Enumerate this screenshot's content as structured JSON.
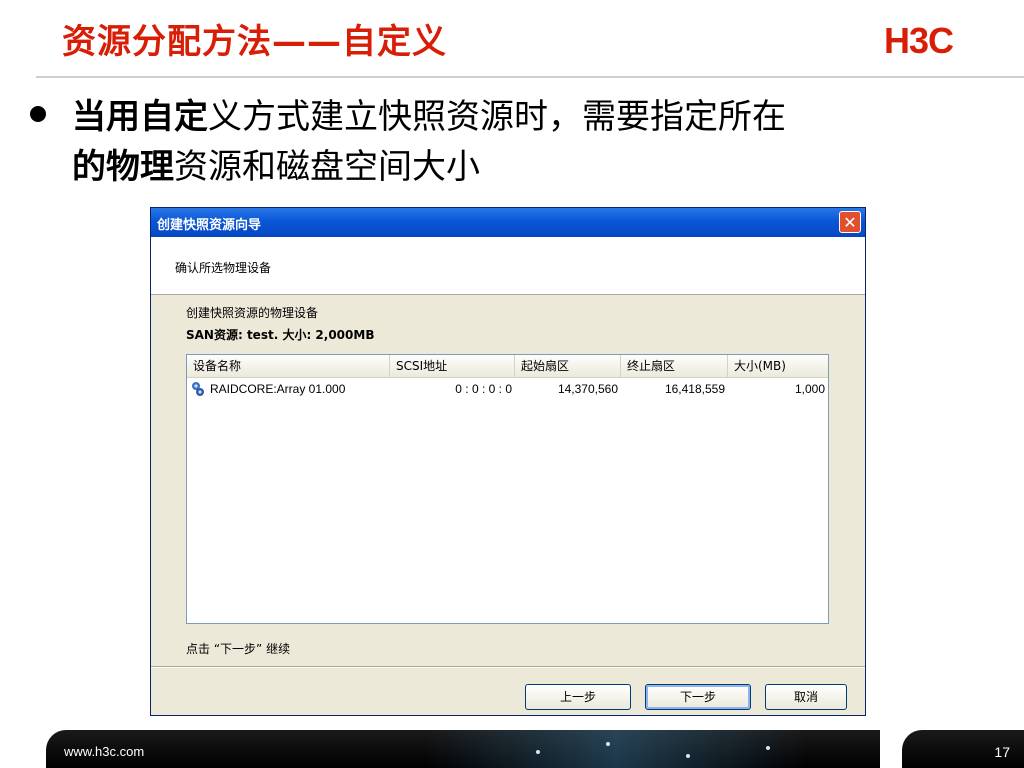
{
  "slide": {
    "title": "资源分配方法——自定义",
    "logo": "H3C",
    "bullet_bold_a": "当用自定",
    "bullet_rest_a": "义方式建立快照资源时，需要指定所在",
    "bullet_bold_b": "的物理",
    "bullet_rest_b": "资源和磁盘空间大小",
    "footer_url": "www.h3c.com",
    "page_number": "17"
  },
  "dialog": {
    "title": "创建快照资源向导",
    "close_glyph": "✕",
    "header": "确认所选物理设备",
    "label_devices": "创建快照资源的物理设备",
    "label_san": "SAN资源: test. 大小: 2,000MB",
    "columns": [
      "设备名称",
      "SCSI地址",
      "起始扇区",
      "终止扇区",
      "大小(MB)"
    ],
    "rows": [
      {
        "name": "RAIDCORE:Array 01.000",
        "scsi": "0 : 0 : 0 : 0",
        "start": "14,370,560",
        "end": "16,418,559",
        "size": "1,000"
      }
    ],
    "footer_note": "点击 “下一步” 继续",
    "buttons": {
      "back": "上一步",
      "next": "下一步",
      "cancel": "取消"
    }
  }
}
